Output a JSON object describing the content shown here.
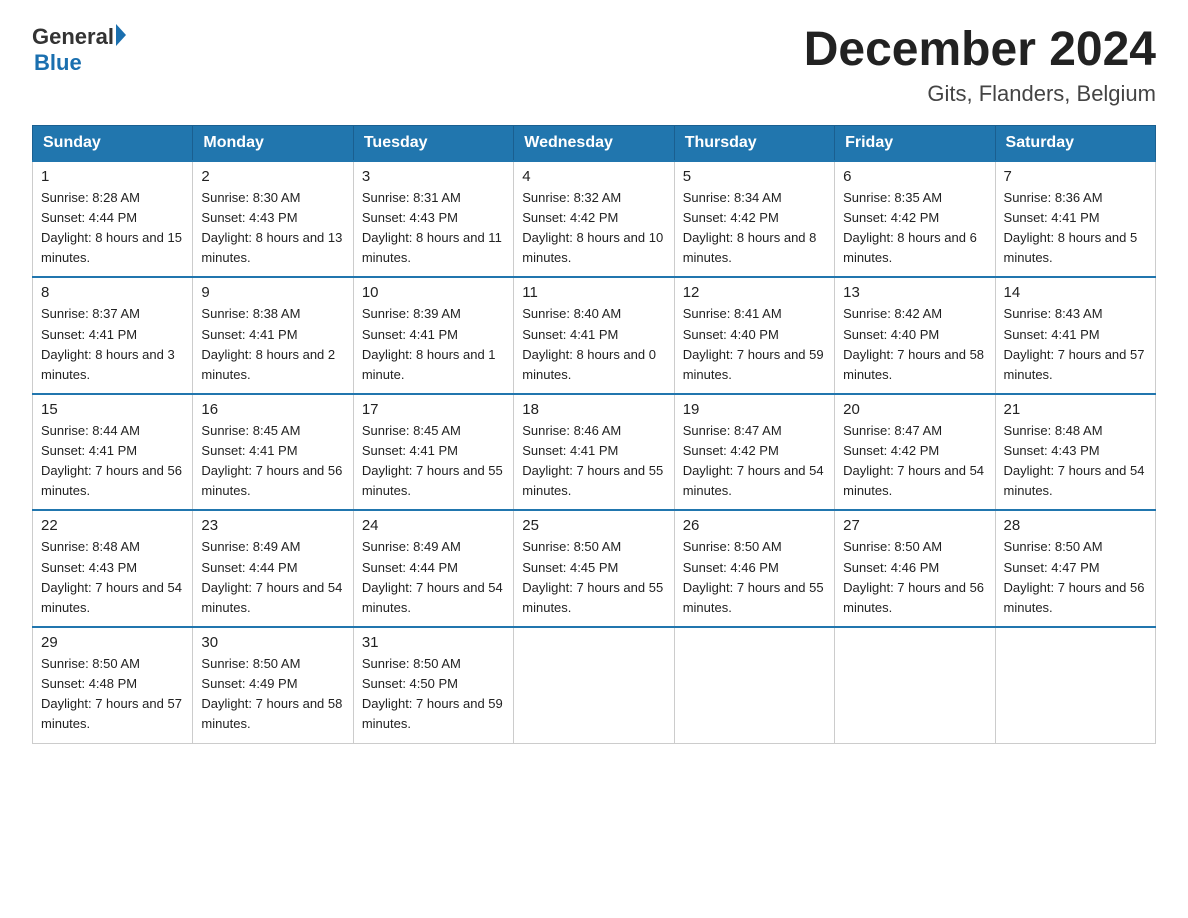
{
  "logo": {
    "general": "General",
    "arrow": "▶",
    "blue": "Blue"
  },
  "header": {
    "title": "December 2024",
    "subtitle": "Gits, Flanders, Belgium"
  },
  "weekdays": [
    "Sunday",
    "Monday",
    "Tuesday",
    "Wednesday",
    "Thursday",
    "Friday",
    "Saturday"
  ],
  "weeks": [
    [
      {
        "day": "1",
        "sunrise": "8:28 AM",
        "sunset": "4:44 PM",
        "daylight": "8 hours and 15 minutes."
      },
      {
        "day": "2",
        "sunrise": "8:30 AM",
        "sunset": "4:43 PM",
        "daylight": "8 hours and 13 minutes."
      },
      {
        "day": "3",
        "sunrise": "8:31 AM",
        "sunset": "4:43 PM",
        "daylight": "8 hours and 11 minutes."
      },
      {
        "day": "4",
        "sunrise": "8:32 AM",
        "sunset": "4:42 PM",
        "daylight": "8 hours and 10 minutes."
      },
      {
        "day": "5",
        "sunrise": "8:34 AM",
        "sunset": "4:42 PM",
        "daylight": "8 hours and 8 minutes."
      },
      {
        "day": "6",
        "sunrise": "8:35 AM",
        "sunset": "4:42 PM",
        "daylight": "8 hours and 6 minutes."
      },
      {
        "day": "7",
        "sunrise": "8:36 AM",
        "sunset": "4:41 PM",
        "daylight": "8 hours and 5 minutes."
      }
    ],
    [
      {
        "day": "8",
        "sunrise": "8:37 AM",
        "sunset": "4:41 PM",
        "daylight": "8 hours and 3 minutes."
      },
      {
        "day": "9",
        "sunrise": "8:38 AM",
        "sunset": "4:41 PM",
        "daylight": "8 hours and 2 minutes."
      },
      {
        "day": "10",
        "sunrise": "8:39 AM",
        "sunset": "4:41 PM",
        "daylight": "8 hours and 1 minute."
      },
      {
        "day": "11",
        "sunrise": "8:40 AM",
        "sunset": "4:41 PM",
        "daylight": "8 hours and 0 minutes."
      },
      {
        "day": "12",
        "sunrise": "8:41 AM",
        "sunset": "4:40 PM",
        "daylight": "7 hours and 59 minutes."
      },
      {
        "day": "13",
        "sunrise": "8:42 AM",
        "sunset": "4:40 PM",
        "daylight": "7 hours and 58 minutes."
      },
      {
        "day": "14",
        "sunrise": "8:43 AM",
        "sunset": "4:41 PM",
        "daylight": "7 hours and 57 minutes."
      }
    ],
    [
      {
        "day": "15",
        "sunrise": "8:44 AM",
        "sunset": "4:41 PM",
        "daylight": "7 hours and 56 minutes."
      },
      {
        "day": "16",
        "sunrise": "8:45 AM",
        "sunset": "4:41 PM",
        "daylight": "7 hours and 56 minutes."
      },
      {
        "day": "17",
        "sunrise": "8:45 AM",
        "sunset": "4:41 PM",
        "daylight": "7 hours and 55 minutes."
      },
      {
        "day": "18",
        "sunrise": "8:46 AM",
        "sunset": "4:41 PM",
        "daylight": "7 hours and 55 minutes."
      },
      {
        "day": "19",
        "sunrise": "8:47 AM",
        "sunset": "4:42 PM",
        "daylight": "7 hours and 54 minutes."
      },
      {
        "day": "20",
        "sunrise": "8:47 AM",
        "sunset": "4:42 PM",
        "daylight": "7 hours and 54 minutes."
      },
      {
        "day": "21",
        "sunrise": "8:48 AM",
        "sunset": "4:43 PM",
        "daylight": "7 hours and 54 minutes."
      }
    ],
    [
      {
        "day": "22",
        "sunrise": "8:48 AM",
        "sunset": "4:43 PM",
        "daylight": "7 hours and 54 minutes."
      },
      {
        "day": "23",
        "sunrise": "8:49 AM",
        "sunset": "4:44 PM",
        "daylight": "7 hours and 54 minutes."
      },
      {
        "day": "24",
        "sunrise": "8:49 AM",
        "sunset": "4:44 PM",
        "daylight": "7 hours and 54 minutes."
      },
      {
        "day": "25",
        "sunrise": "8:50 AM",
        "sunset": "4:45 PM",
        "daylight": "7 hours and 55 minutes."
      },
      {
        "day": "26",
        "sunrise": "8:50 AM",
        "sunset": "4:46 PM",
        "daylight": "7 hours and 55 minutes."
      },
      {
        "day": "27",
        "sunrise": "8:50 AM",
        "sunset": "4:46 PM",
        "daylight": "7 hours and 56 minutes."
      },
      {
        "day": "28",
        "sunrise": "8:50 AM",
        "sunset": "4:47 PM",
        "daylight": "7 hours and 56 minutes."
      }
    ],
    [
      {
        "day": "29",
        "sunrise": "8:50 AM",
        "sunset": "4:48 PM",
        "daylight": "7 hours and 57 minutes."
      },
      {
        "day": "30",
        "sunrise": "8:50 AM",
        "sunset": "4:49 PM",
        "daylight": "7 hours and 58 minutes."
      },
      {
        "day": "31",
        "sunrise": "8:50 AM",
        "sunset": "4:50 PM",
        "daylight": "7 hours and 59 minutes."
      },
      null,
      null,
      null,
      null
    ]
  ]
}
